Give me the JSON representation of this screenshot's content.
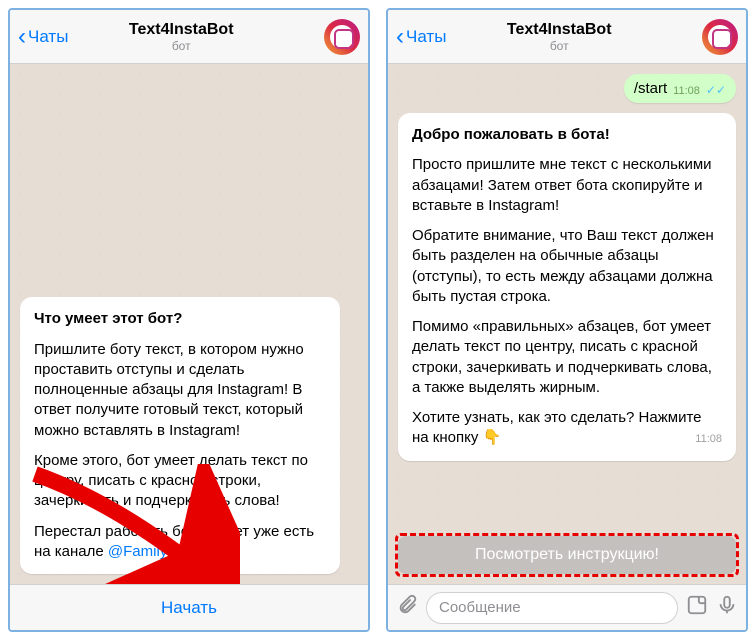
{
  "header": {
    "back_label": "Чаты",
    "title": "Text4InstaBot",
    "subtitle": "бот"
  },
  "left": {
    "heading": "Что умеет этот бот?",
    "p1": "Пришлите боту текст, в котором нужно проставить отступы и сделать полноценные абзацы для Instagram! В ответ получите готовый текст, который можно вставлять в Instagram!",
    "p2": "Кроме этого, бот умеет делать текст по центру, писать с красной строки, зачеркивать и подчеркивать слова!",
    "p3a": "Перестал работать бот? Ответ уже есть на канале ",
    "p3link": "@FamilyBots",
    "start_button": "Начать"
  },
  "right": {
    "user_msg": "/start",
    "user_time": "11:08",
    "heading": "Добро пожаловать в бота!",
    "p1": "Просто пришлите мне текст с несколькими абзацами! Затем ответ бота скопируйте и вставьте в Instagram!",
    "p2": "Обратите внимание, что Ваш текст должен быть разделен на обычные абзацы (отступы), то есть между абзацами должна быть пустая строка.",
    "p3": "Помимо «правильных» абзацев, бот умеет делать текст по центру, писать с красной строки, зачеркивать и подчеркивать слова, а также выделять жирным.",
    "p4": "Хотите узнать, как это сделать? Нажмите на кнопку ",
    "emoji": "👇",
    "time": "11:08",
    "bot_button": "Посмотреть инструкцию!",
    "input_placeholder": "Сообщение"
  }
}
